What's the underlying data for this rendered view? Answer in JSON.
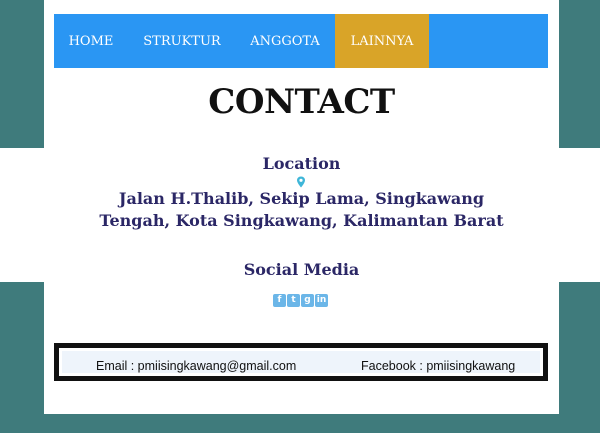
{
  "nav": {
    "items": [
      {
        "label": "HOME"
      },
      {
        "label": "STRUKTUR"
      },
      {
        "label": "ANGGOTA"
      },
      {
        "label": "LAINNYA",
        "active": true
      }
    ]
  },
  "page": {
    "title": "CONTACT"
  },
  "location": {
    "heading": "Location",
    "icon": "map-pin-icon",
    "address": "Jalan H.Thalib, Sekip Lama, Singkawang Tengah, Kota Singkawang, Kalimantan Barat"
  },
  "social": {
    "heading": "Social Media",
    "icons": [
      "facebook-icon",
      "twitter-icon",
      "google-plus-icon",
      "linkedin-icon"
    ]
  },
  "contact_bar": {
    "email": "Email : pmiisingkawang@gmail.com",
    "facebook": "Facebook : pmiisingkawang"
  },
  "colors": {
    "background_band": "#3f7b7c",
    "navbar": "#2a96f3",
    "nav_active": "#d9a428",
    "heading_text": "#2b2766",
    "social_icon": "#6bb6e8"
  }
}
